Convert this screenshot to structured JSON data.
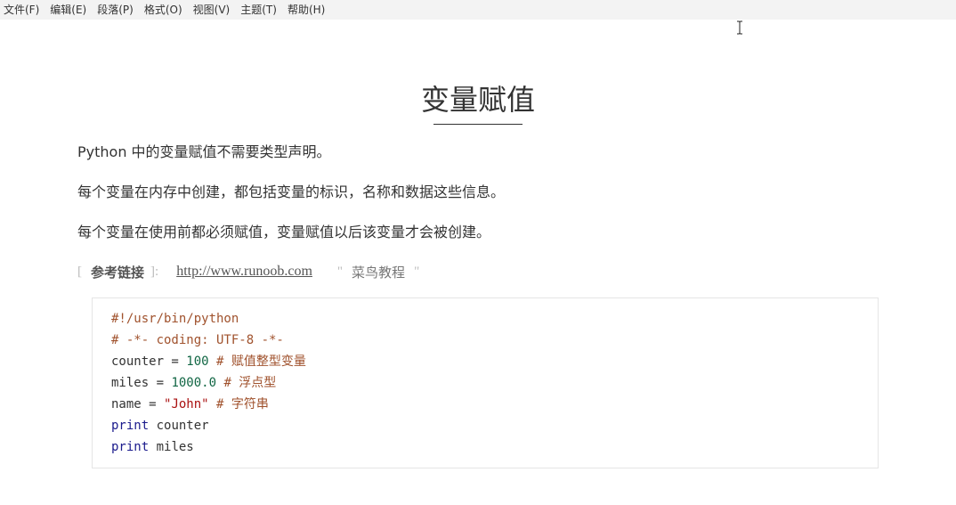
{
  "menubar": {
    "items": [
      {
        "label": "文件(F)"
      },
      {
        "label": "编辑(E)"
      },
      {
        "label": "段落(P)"
      },
      {
        "label": "格式(O)"
      },
      {
        "label": "视图(V)"
      },
      {
        "label": "主题(T)"
      },
      {
        "label": "帮助(H)"
      }
    ]
  },
  "cursor": {
    "icon": "text-cursor-icon"
  },
  "document": {
    "title": "变量赋值",
    "paragraphs": [
      "Python 中的变量赋值不需要类型声明。",
      "每个变量在内存中创建，都包括变量的标识，名称和数据这些信息。",
      "每个变量在使用前都必须赋值，变量赋值以后该变量才会被创建。"
    ],
    "reference": {
      "open_bracket": "[",
      "label": "参考链接",
      "close_bracket": "]",
      "colon": ":",
      "url": "http://www.runoob.com",
      "quote_open": "\"",
      "link_title": "菜鸟教程",
      "quote_close": "\""
    },
    "code": {
      "language": "python",
      "lines": [
        [
          {
            "t": "#!/usr/bin/python",
            "k": "comment"
          }
        ],
        [
          {
            "t": "# -*- coding: UTF-8 -*-",
            "k": "comment"
          }
        ],
        [
          {
            "t": "counter = ",
            "k": "plain"
          },
          {
            "t": "100",
            "k": "num"
          },
          {
            "t": " ",
            "k": "plain"
          },
          {
            "t": "# 赋值整型变量",
            "k": "comment"
          }
        ],
        [
          {
            "t": "miles = ",
            "k": "plain"
          },
          {
            "t": "1000.0",
            "k": "num"
          },
          {
            "t": " ",
            "k": "plain"
          },
          {
            "t": "# 浮点型",
            "k": "comment"
          }
        ],
        [
          {
            "t": "name = ",
            "k": "plain"
          },
          {
            "t": "\"John\"",
            "k": "str"
          },
          {
            "t": " ",
            "k": "plain"
          },
          {
            "t": "# 字符串",
            "k": "comment"
          }
        ],
        [
          {
            "t": "print",
            "k": "kw"
          },
          {
            "t": " counter",
            "k": "plain"
          }
        ],
        [
          {
            "t": "print",
            "k": "kw"
          },
          {
            "t": " miles",
            "k": "plain"
          }
        ]
      ]
    }
  },
  "colors": {
    "menubar_bg": "#f3f3f3",
    "text": "#333333",
    "comment": "#a0522d",
    "number": "#116644",
    "string": "#aa1111",
    "keyword": "#1a1a8c",
    "code_border": "#e5e5e5"
  }
}
